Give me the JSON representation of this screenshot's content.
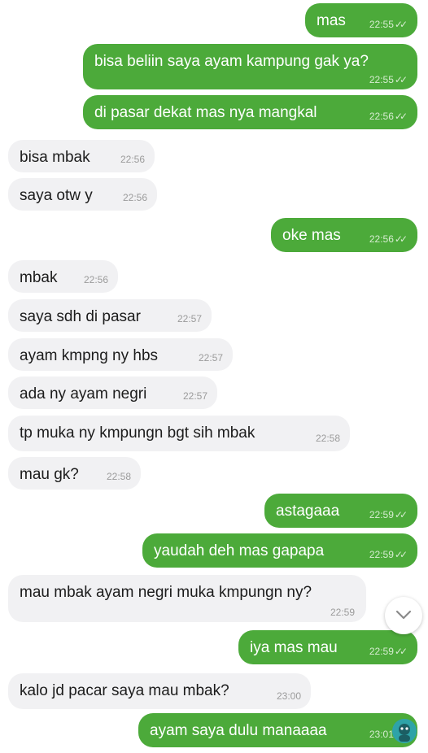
{
  "colors": {
    "outgoing": "#4caa3a",
    "incoming": "#f1f1f3"
  },
  "read_ticks": "✓✓",
  "scroll_down_icon": "chevron-down-icon",
  "messages": [
    {
      "dir": "out",
      "text": "mas",
      "time": "22:55"
    },
    {
      "dir": "out",
      "text": "bisa beliin saya ayam kampung gak ya?",
      "time": "22:55"
    },
    {
      "dir": "out",
      "text": "di pasar dekat mas nya mangkal",
      "time": "22:56"
    },
    {
      "dir": "in",
      "text": "bisa mbak",
      "time": "22:56"
    },
    {
      "dir": "in",
      "text": "saya otw y",
      "time": "22:56"
    },
    {
      "dir": "out",
      "text": "oke mas",
      "time": "22:56"
    },
    {
      "dir": "in",
      "text": "mbak",
      "time": "22:56"
    },
    {
      "dir": "in",
      "text": "saya sdh di pasar",
      "time": "22:57"
    },
    {
      "dir": "in",
      "text": "ayam kmpng ny hbs",
      "time": "22:57"
    },
    {
      "dir": "in",
      "text": "ada ny ayam negri",
      "time": "22:57"
    },
    {
      "dir": "in",
      "text": "tp muka ny kmpungn bgt sih mbak",
      "time": "22:58"
    },
    {
      "dir": "in",
      "text": "mau gk?",
      "time": "22:58"
    },
    {
      "dir": "out",
      "text": "astagaaa",
      "time": "22:59"
    },
    {
      "dir": "out",
      "text": "yaudah deh mas gapapa",
      "time": "22:59"
    },
    {
      "dir": "in",
      "text": "mau mbak ayam negri muka kmpungn ny?",
      "time": "22:59"
    },
    {
      "dir": "out",
      "text": "iya mas mau",
      "time": "22:59"
    },
    {
      "dir": "in",
      "text": "kalo jd pacar saya mau mbak?",
      "time": "23:00"
    },
    {
      "dir": "out",
      "text": "ayam saya dulu manaaaa",
      "time": "23:01"
    }
  ]
}
